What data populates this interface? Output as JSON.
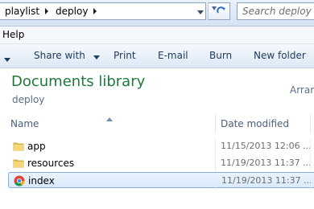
{
  "address": {
    "breadcrumbs": [
      {
        "label": "playlist"
      },
      {
        "label": "deploy"
      }
    ],
    "search_placeholder": "Search deploy"
  },
  "menu": {
    "help": "Help"
  },
  "toolbar": {
    "share_with": "Share with",
    "print": "Print",
    "email": "E-mail",
    "burn": "Burn",
    "new_folder": "New folder"
  },
  "library": {
    "title": "Documents library",
    "subtitle": "deploy",
    "arrange": "Arran"
  },
  "columns": {
    "name": "Name",
    "date": "Date modified"
  },
  "files": [
    {
      "name": "app",
      "date": "11/15/2013 12:06 ...",
      "icon": "folder-icon"
    },
    {
      "name": "resources",
      "date": "11/19/2013 11:37 ...",
      "icon": "folder-icon"
    },
    {
      "name": "index",
      "date": "11/19/2013 11:37 ...",
      "icon": "chrome-html-icon",
      "selected": true
    }
  ],
  "colors": {
    "library_title": "#1e7a3c",
    "toolbar_text": "#1e395b",
    "selection_border": "#84acdd"
  }
}
